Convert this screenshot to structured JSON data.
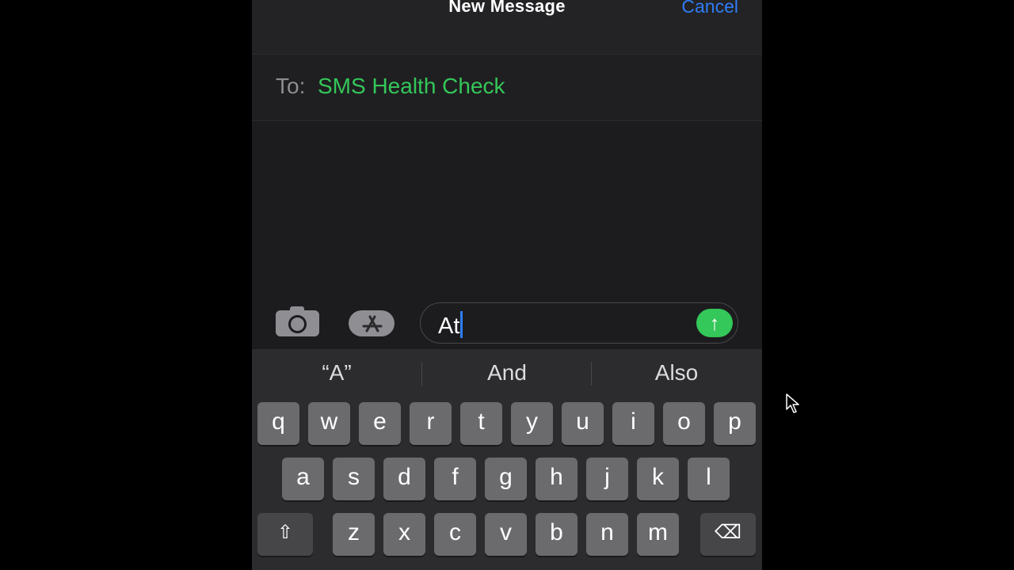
{
  "nav": {
    "title": "New Message",
    "cancel_label": "Cancel"
  },
  "recipient": {
    "label": "To:",
    "name": "SMS Health Check"
  },
  "compose": {
    "text": "At",
    "camera_icon": "camera-icon",
    "apps_icon": "app-store-icon",
    "send_icon": "arrow-up-icon",
    "send_glyph": "↑"
  },
  "suggestions": [
    "“A”",
    "And",
    "Also"
  ],
  "keyboard": {
    "row1": [
      "q",
      "w",
      "e",
      "r",
      "t",
      "y",
      "u",
      "i",
      "o",
      "p"
    ],
    "row2": [
      "a",
      "s",
      "d",
      "f",
      "g",
      "h",
      "j",
      "k",
      "l"
    ],
    "row3": [
      "z",
      "x",
      "c",
      "v",
      "b",
      "n",
      "m"
    ],
    "shift_glyph": "⇧",
    "delete_glyph": "⌫"
  },
  "colors": {
    "accent_blue": "#2f7cf6",
    "recipient_green": "#34c759",
    "send_green": "#34c759",
    "background": "#1c1c1e"
  }
}
